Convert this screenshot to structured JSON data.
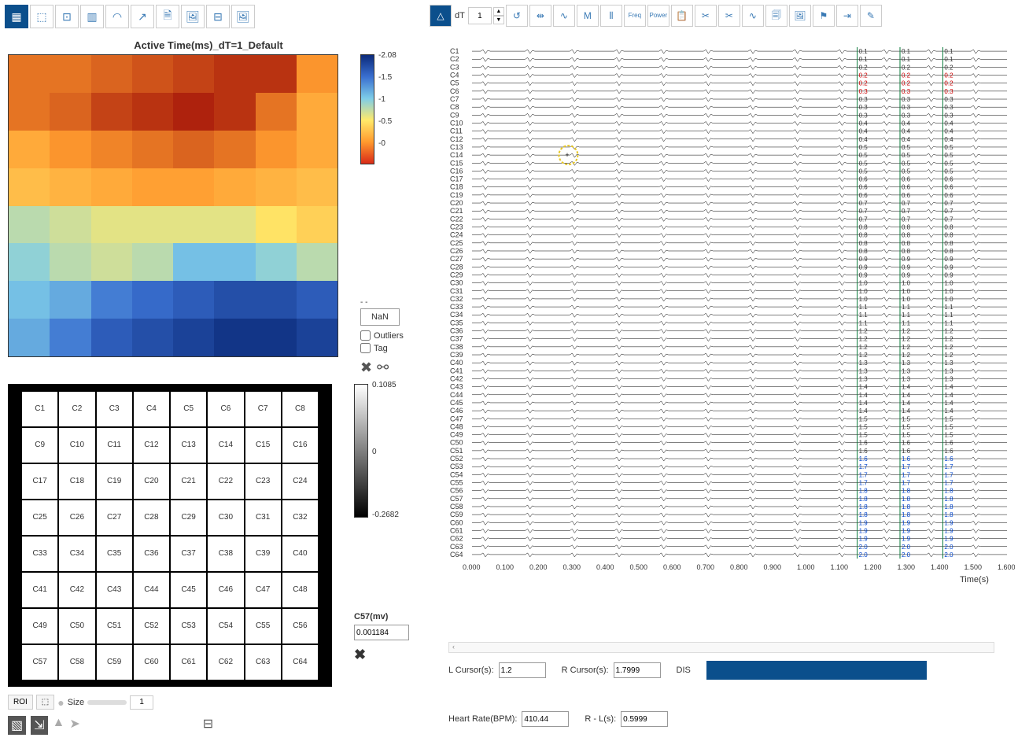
{
  "leftToolbar": [
    {
      "name": "grid-icon",
      "glyph": "▦",
      "active": true
    },
    {
      "name": "select-icon",
      "glyph": "⬚"
    },
    {
      "name": "target-icon",
      "glyph": "⊡"
    },
    {
      "name": "chart-icon",
      "glyph": "▥"
    },
    {
      "name": "gauge-icon",
      "glyph": "◠"
    },
    {
      "name": "export-icon",
      "glyph": "↗"
    },
    {
      "name": "page-icon",
      "glyph": "🗎"
    },
    {
      "name": "image-icon",
      "glyph": "🖼"
    },
    {
      "name": "film-icon",
      "glyph": "⊟"
    },
    {
      "name": "image-plus-icon",
      "glyph": "🖼"
    }
  ],
  "heatmap": {
    "title": "Active Time(ms)_dT=1_Default",
    "colorbar": {
      "ticks": [
        "2.08",
        "1.5",
        "1",
        "0.5",
        "0"
      ]
    },
    "nan_label": "NaN",
    "outliers_label": "Outliers",
    "tag_label": "Tag"
  },
  "grid": {
    "colorbar": {
      "top": "0.1085",
      "mid": "0",
      "bottom": "-0.2682"
    },
    "selected_label": "C57(mv)",
    "selected_value": "0.001184"
  },
  "roi": {
    "label": "ROI",
    "size_label": "Size",
    "size_value": "1"
  },
  "rightToolbar": {
    "dt_label": "dT",
    "dt_value": "1",
    "buttons": [
      {
        "name": "peak-icon",
        "glyph": "△",
        "active": true
      },
      {
        "name": "refresh-icon",
        "glyph": "↺"
      },
      {
        "name": "cursor-pair-icon",
        "glyph": "⇹"
      },
      {
        "name": "wave-icon",
        "glyph": "∿"
      },
      {
        "name": "m-icon",
        "glyph": "M"
      },
      {
        "name": "bars-icon",
        "glyph": "⫴"
      },
      {
        "name": "freq-icon",
        "glyph": "Freq",
        "txt": true
      },
      {
        "name": "power-icon",
        "glyph": "Power",
        "txt": true
      },
      {
        "name": "clipboard-icon",
        "glyph": "📋"
      },
      {
        "name": "cut-icon",
        "glyph": "✂"
      },
      {
        "name": "cut2-icon",
        "glyph": "✂"
      },
      {
        "name": "pulse-icon",
        "glyph": "∿"
      },
      {
        "name": "copy-icon",
        "glyph": "🗐"
      },
      {
        "name": "picture-icon",
        "glyph": "🖼"
      },
      {
        "name": "flag-icon",
        "glyph": "⚑"
      },
      {
        "name": "goto-icon",
        "glyph": "⇥"
      },
      {
        "name": "edit-icon",
        "glyph": "✎"
      }
    ]
  },
  "waveform": {
    "channels": 64,
    "xticks": [
      "0.000",
      "0.100",
      "0.200",
      "0.300",
      "0.400",
      "0.500",
      "0.600",
      "0.700",
      "0.800",
      "0.900",
      "1.000",
      "1.100",
      "1.200",
      "1.300",
      "1.400",
      "1.500",
      "1.600"
    ],
    "xlabel": "Time(s)",
    "cursor_marker_channel": 14
  },
  "readout": {
    "lcursor_label": "L Cursor(s):",
    "lcursor_value": "1.2",
    "rcursor_label": "R Cursor(s):",
    "rcursor_value": "1.7999",
    "dis_label": "DIS",
    "hr_label": "Heart Rate(BPM):",
    "hr_value": "410.44",
    "rl_label": "R - L(s):",
    "rl_value": "0.5999"
  },
  "chart_data": {
    "type": "heatmap",
    "title": "Active Time(ms)_dT=1_Default",
    "rows": 8,
    "cols": 8,
    "colormap": "jet",
    "value_range": [
      0,
      2.08
    ],
    "values": [
      [
        0.3,
        0.3,
        0.25,
        0.2,
        0.15,
        0.1,
        0.1,
        0.4
      ],
      [
        0.3,
        0.25,
        0.15,
        0.1,
        0.05,
        0.1,
        0.3,
        0.5
      ],
      [
        0.5,
        0.4,
        0.35,
        0.3,
        0.25,
        0.3,
        0.4,
        0.5
      ],
      [
        0.6,
        0.55,
        0.5,
        0.45,
        0.45,
        0.5,
        0.55,
        0.6
      ],
      [
        1.0,
        0.95,
        0.9,
        0.9,
        0.9,
        0.9,
        0.8,
        0.7
      ],
      [
        1.1,
        1.0,
        0.95,
        1.0,
        1.2,
        1.2,
        1.1,
        1.0
      ],
      [
        1.2,
        1.3,
        1.5,
        1.6,
        1.7,
        1.8,
        1.8,
        1.7
      ],
      [
        1.3,
        1.5,
        1.7,
        1.8,
        1.9,
        2.0,
        2.0,
        1.9
      ]
    ]
  }
}
